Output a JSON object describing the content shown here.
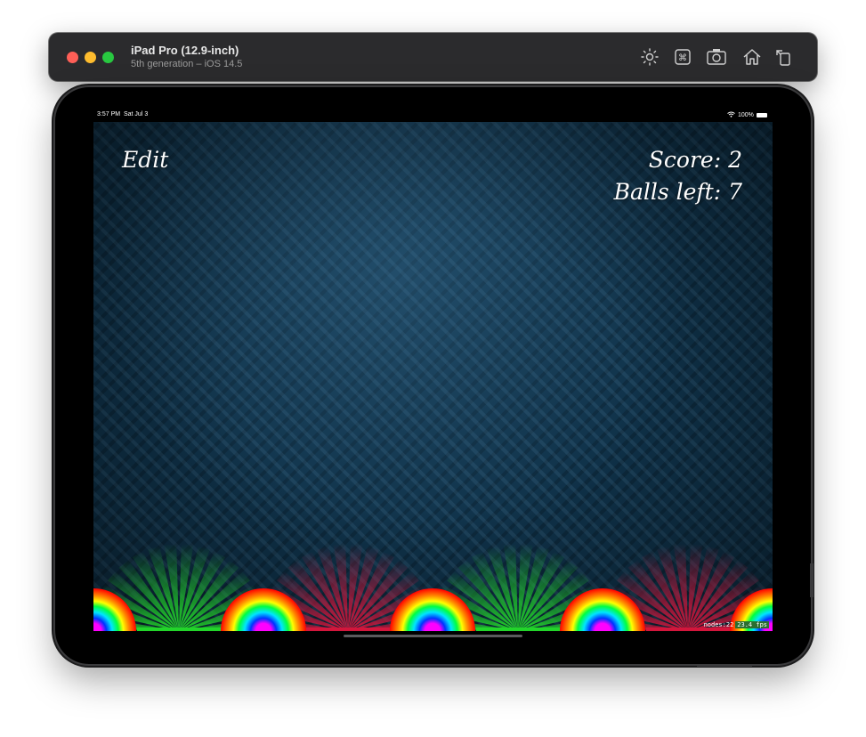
{
  "simulator": {
    "title": "iPad Pro (12.9-inch)",
    "subtitle": "5th generation – iOS 14.5",
    "toolbar_icons": [
      "brightness-icon",
      "command-icon",
      "screenshot-icon",
      "home-icon",
      "rotate-icon"
    ]
  },
  "status_bar": {
    "time": "3:57 PM",
    "date": "Sat Jul 3",
    "battery": "100%"
  },
  "game": {
    "edit_label": "Edit",
    "score_text": "Score: 2",
    "balls_left_text": "Balls left: 7"
  },
  "debug": {
    "nodes": "nodes:22",
    "fps": "23.4 fps"
  },
  "colors": {
    "background": "#0f3148",
    "good_slot": "#22d52a",
    "bad_slot": "#d3163c"
  }
}
